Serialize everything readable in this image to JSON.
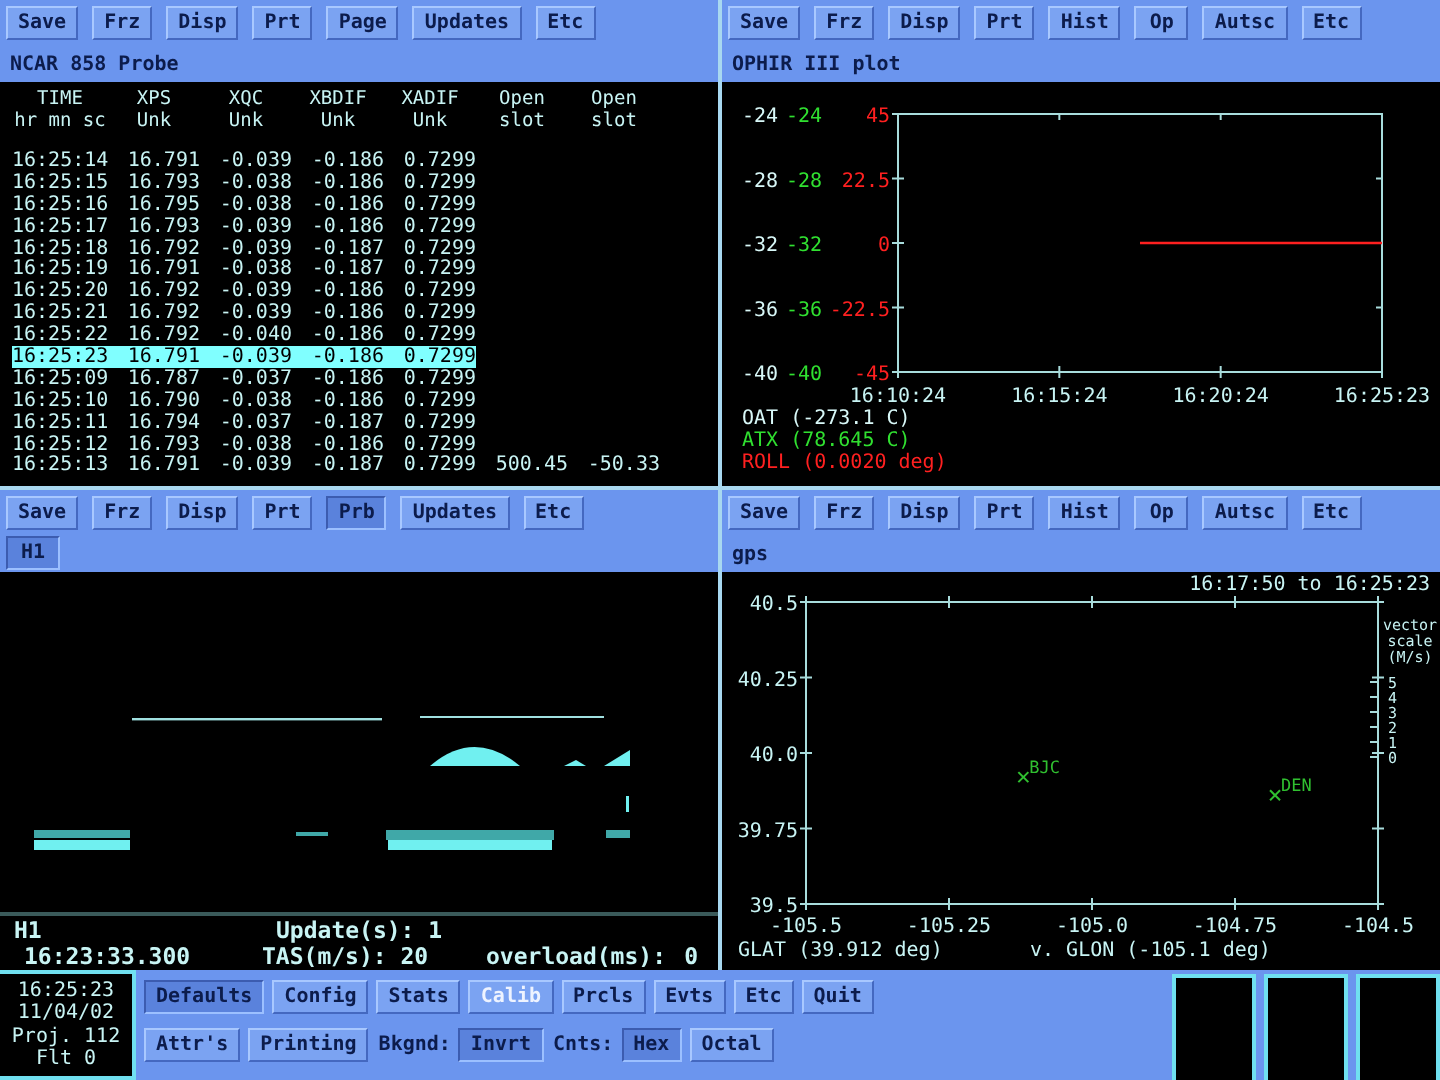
{
  "table_panel": {
    "buttons": [
      {
        "label": "Save",
        "selected": false
      },
      {
        "label": "Frz",
        "selected": false
      },
      {
        "label": "Disp",
        "selected": false
      },
      {
        "label": "Prt",
        "selected": false
      },
      {
        "label": "Page",
        "selected": false
      },
      {
        "label": "Updates",
        "selected": false
      },
      {
        "label": "Etc",
        "selected": false
      }
    ],
    "title": "NCAR 858 Probe",
    "columns": [
      {
        "name": "TIME",
        "unit": "hr mn sc"
      },
      {
        "name": "XPS",
        "unit": "Unk"
      },
      {
        "name": "XQC",
        "unit": "Unk"
      },
      {
        "name": "XBDIF",
        "unit": "Unk"
      },
      {
        "name": "XADIF",
        "unit": "Unk"
      },
      {
        "name": "Open",
        "unit": "slot"
      },
      {
        "name": "Open",
        "unit": "slot"
      }
    ],
    "rows": [
      {
        "cells": [
          "16:25:14",
          "16.791",
          "-0.039",
          "-0.186",
          "0.7299"
        ],
        "selected": false
      },
      {
        "cells": [
          "16:25:15",
          "16.793",
          "-0.038",
          "-0.186",
          "0.7299"
        ],
        "selected": false
      },
      {
        "cells": [
          "16:25:16",
          "16.795",
          "-0.038",
          "-0.186",
          "0.7299"
        ],
        "selected": false
      },
      {
        "cells": [
          "16:25:17",
          "16.793",
          "-0.039",
          "-0.186",
          "0.7299"
        ],
        "selected": false
      },
      {
        "cells": [
          "16:25:18",
          "16.792",
          "-0.039",
          "-0.187",
          "0.7299"
        ],
        "selected": false
      },
      {
        "cells": [
          "16:25:19",
          "16.791",
          "-0.038",
          "-0.187",
          "0.7299"
        ],
        "selected": false
      },
      {
        "cells": [
          "16:25:20",
          "16.792",
          "-0.039",
          "-0.186",
          "0.7299"
        ],
        "selected": false
      },
      {
        "cells": [
          "16:25:21",
          "16.792",
          "-0.039",
          "-0.186",
          "0.7299"
        ],
        "selected": false
      },
      {
        "cells": [
          "16:25:22",
          "16.792",
          "-0.040",
          "-0.186",
          "0.7299"
        ],
        "selected": false
      },
      {
        "cells": [
          "16:25:23",
          "16.791",
          "-0.039",
          "-0.186",
          "0.7299"
        ],
        "selected": true
      },
      {
        "cells": [
          "16:25:09",
          "16.787",
          "-0.037",
          "-0.186",
          "0.7299"
        ],
        "selected": false
      },
      {
        "cells": [
          "16:25:10",
          "16.790",
          "-0.038",
          "-0.186",
          "0.7299"
        ],
        "selected": false
      },
      {
        "cells": [
          "16:25:11",
          "16.794",
          "-0.037",
          "-0.187",
          "0.7299"
        ],
        "selected": false
      },
      {
        "cells": [
          "16:25:12",
          "16.793",
          "-0.038",
          "-0.186",
          "0.7299"
        ],
        "selected": false
      },
      {
        "cells": [
          "16:25:13",
          "16.791",
          "-0.039",
          "-0.187",
          "0.7299",
          "500.45",
          "-50.33"
        ],
        "selected": false
      }
    ]
  },
  "plot_panel": {
    "buttons": [
      {
        "label": "Save",
        "selected": false
      },
      {
        "label": "Frz",
        "selected": false
      },
      {
        "label": "Disp",
        "selected": false
      },
      {
        "label": "Prt",
        "selected": false
      },
      {
        "label": "Hist",
        "selected": false
      },
      {
        "label": "Op",
        "selected": false
      },
      {
        "label": "Autsc",
        "selected": false
      },
      {
        "label": "Etc",
        "selected": false
      }
    ],
    "title": "OPHIR III plot",
    "side_axes": [
      {
        "color": "#d8f8f8",
        "ticks": [
          "-24",
          "-28",
          "-32",
          "-36",
          "-40"
        ]
      },
      {
        "color": "#30e030",
        "ticks": [
          "-24",
          "-28",
          "-32",
          "-36",
          "-40"
        ]
      }
    ],
    "chart_data": {
      "type": "line",
      "categories": [
        "16:10:24",
        null,
        "16:15:24",
        null,
        "16:20:24",
        null,
        "16:25:23"
      ],
      "ylim": [
        -45,
        45
      ],
      "yticks": [
        {
          "value": 45,
          "label": "45"
        },
        {
          "value": 22.5,
          "label": "22.5"
        },
        {
          "value": 0,
          "label": "0"
        },
        {
          "value": -22.5,
          "label": "-22.5"
        },
        {
          "value": -45,
          "label": "-45"
        }
      ],
      "series": [
        {
          "color": "#ff2020",
          "values": [
            null,
            null,
            null,
            0,
            0,
            0,
            0
          ]
        }
      ]
    },
    "legend": [
      {
        "text": "OAT (-273.1 C)",
        "color": "#d8f8f8"
      },
      {
        "text": "ATX (78.645 C)",
        "color": "#30e030"
      },
      {
        "text": "ROLL (0.0020 deg)",
        "color": "#ff2020"
      }
    ]
  },
  "probe_panel": {
    "buttons": [
      {
        "label": "Save",
        "selected": false
      },
      {
        "label": "Frz",
        "selected": false
      },
      {
        "label": "Disp",
        "selected": false
      },
      {
        "label": "Prt",
        "selected": false
      },
      {
        "label": "Prb",
        "selected": true
      },
      {
        "label": "Updates",
        "selected": false
      },
      {
        "label": "Etc",
        "selected": false
      }
    ],
    "tabs": [
      {
        "label": "H1",
        "selected": true
      }
    ],
    "footer": {
      "probe": "H1",
      "updates": "Update(s): 1",
      "time": "16:23:33.300",
      "tas": "TAS(m/s): 20",
      "overload_label": "overload(ms):",
      "overload": "0"
    }
  },
  "map_panel": {
    "buttons": [
      {
        "label": "Save",
        "selected": false
      },
      {
        "label": "Frz",
        "selected": false
      },
      {
        "label": "Disp",
        "selected": false
      },
      {
        "label": "Prt",
        "selected": false
      },
      {
        "label": "Hist",
        "selected": false
      },
      {
        "label": "Op",
        "selected": false
      },
      {
        "label": "Autsc",
        "selected": false
      },
      {
        "label": "Etc",
        "selected": false
      }
    ],
    "title": "gps",
    "time_range": "16:17:50 to 16:25:23",
    "chart_data": {
      "type": "scatter",
      "x": [
        -105.12,
        -104.68
      ],
      "xlim": [
        -105.5,
        -104.5
      ],
      "ylim": [
        39.5,
        40.5
      ],
      "xticks": [
        {
          "value": -105.5,
          "label": "-105.5"
        },
        {
          "value": -105.25,
          "label": "-105.25"
        },
        {
          "value": -105,
          "label": "-105.0"
        },
        {
          "value": -104.75,
          "label": "-104.75"
        },
        {
          "value": -104.5,
          "label": "-104.5"
        }
      ],
      "yticks": [
        {
          "value": 40.5,
          "label": "40.5"
        },
        {
          "value": 40.25,
          "label": "40.25"
        },
        {
          "value": 40,
          "label": "40.0"
        },
        {
          "value": 39.75,
          "label": "39.75"
        },
        {
          "value": 39.5,
          "label": "39.5"
        }
      ],
      "series": [
        {
          "color": "#30c030",
          "values": [
            39.92,
            39.86
          ]
        }
      ],
      "annotations": [
        {
          "x": -105.12,
          "y": 39.92,
          "text": "BJC"
        },
        {
          "x": -104.68,
          "y": 39.86,
          "text": "DEN"
        }
      ],
      "ylabel": "GLAT (39.912 deg)",
      "xlabel": "v. GLON (-105.1 deg)"
    },
    "vector_scale": {
      "title": [
        "vector",
        "scale",
        "(M/s)"
      ],
      "ticks": [
        "5",
        "4",
        "3",
        "2",
        "1",
        "0"
      ]
    }
  },
  "status_bar": {
    "info": [
      "16:25:23",
      "11/04/02",
      "Proj. 112",
      "Flt 0"
    ],
    "row_1": [
      {
        "label": "Defaults",
        "selected": true,
        "disabled": false
      },
      {
        "label": "Config",
        "selected": false,
        "disabled": false
      },
      {
        "label": "Stats",
        "selected": false,
        "disabled": false
      },
      {
        "label": "Calib",
        "selected": false,
        "disabled": true
      },
      {
        "label": "Prcls",
        "selected": false,
        "disabled": false
      },
      {
        "label": "Evts",
        "selected": false,
        "disabled": false
      },
      {
        "label": "Etc",
        "selected": false,
        "disabled": false
      },
      {
        "label": "Quit",
        "selected": false,
        "disabled": false
      }
    ],
    "row_2": [
      {
        "buttons": [
          {
            "label": "Attr's",
            "selected": false
          },
          {
            "label": "Printing",
            "selected": false
          }
        ]
      },
      {
        "label": "Bkgnd:",
        "buttons": [
          {
            "label": "Invrt",
            "selected": true
          }
        ]
      },
      {
        "label": "Cnts:",
        "buttons": [
          {
            "label": "Hex",
            "selected": true
          },
          {
            "label": "Octal",
            "selected": false
          }
        ]
      }
    ]
  }
}
